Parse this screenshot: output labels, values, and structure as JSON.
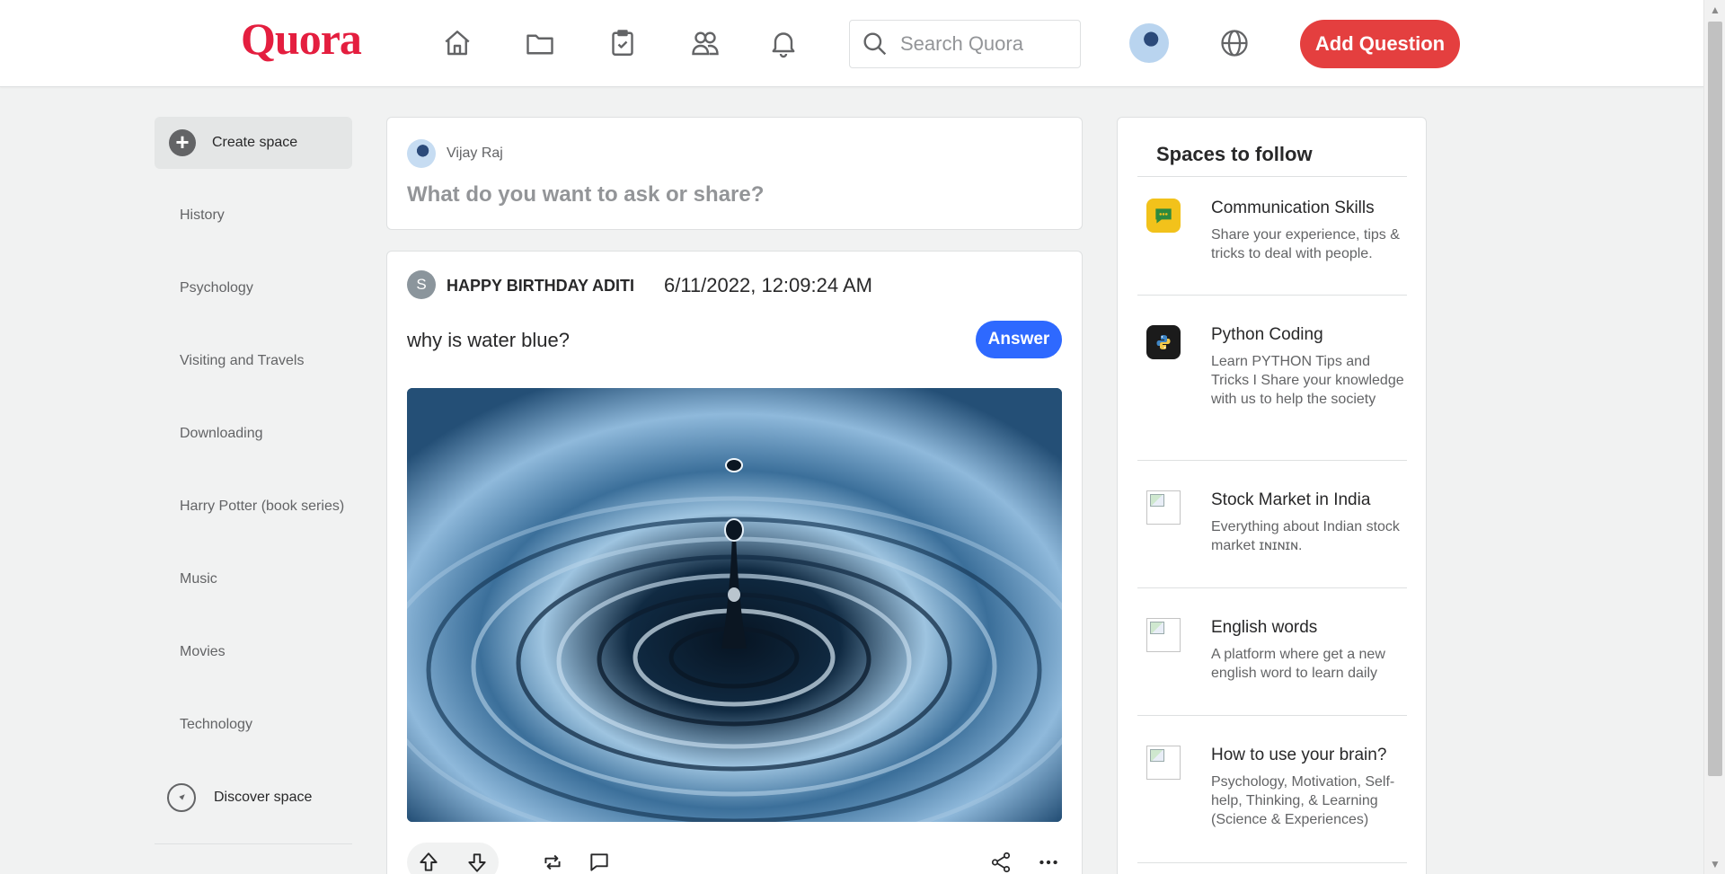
{
  "header": {
    "logo": "Quora",
    "nav_icons": [
      "home-icon",
      "following-icon",
      "answer-icon",
      "spaces-icon",
      "notifications-icon"
    ],
    "search_placeholder": "Search Quora",
    "add_question_label": "Add Question",
    "accent_color": "#e43f3f",
    "logo_color": "#e41e3f"
  },
  "sidebar": {
    "create_space_label": "Create space",
    "items": [
      {
        "label": "History"
      },
      {
        "label": "Psychology"
      },
      {
        "label": "Visiting and Travels"
      },
      {
        "label": "Downloading"
      },
      {
        "label": "Harry Potter (book series)"
      },
      {
        "label": "Music"
      },
      {
        "label": "Movies"
      },
      {
        "label": "Technology"
      }
    ],
    "discover_label": "Discover space"
  },
  "composer": {
    "user_name": "Vijay Raj",
    "prompt": "What do you want to ask or share?"
  },
  "post": {
    "avatar_letter": "S",
    "author": "HAPPY BIRTHDAY ADITI",
    "timestamp": "6/11/2022, 12:09:24 AM",
    "question": "why is water blue?",
    "answer_label": "Answer",
    "answer_color": "#2e69ff",
    "image": "water-drop-ripples",
    "actions": [
      "upvote-icon",
      "downvote-icon",
      "reshare-icon",
      "comment-icon",
      "share-icon",
      "more-icon"
    ]
  },
  "spaces_to_follow": {
    "title": "Spaces to follow",
    "items": [
      {
        "name": "Communication Skills",
        "description": "Share your experience, tips & tricks to deal with people.",
        "icon": "communication-skills-icon"
      },
      {
        "name": "Python Coding",
        "description": "Learn PYTHON Tips and Tricks I Share your knowledge with us to help the society",
        "icon": "python-coding-icon"
      },
      {
        "name": "Stock Market in India",
        "description": "Everything about Indian stock market ɪɴɪɴɪɴ.",
        "icon": "broken-image-icon"
      },
      {
        "name": "English words",
        "description": "A platform where get a new english word to learn daily",
        "icon": "broken-image-icon"
      },
      {
        "name": "How to use your brain?",
        "description": "Psychology, Motivation, Self-help, Thinking, & Learning (Science & Experiences)",
        "icon": "broken-image-icon"
      }
    ]
  }
}
